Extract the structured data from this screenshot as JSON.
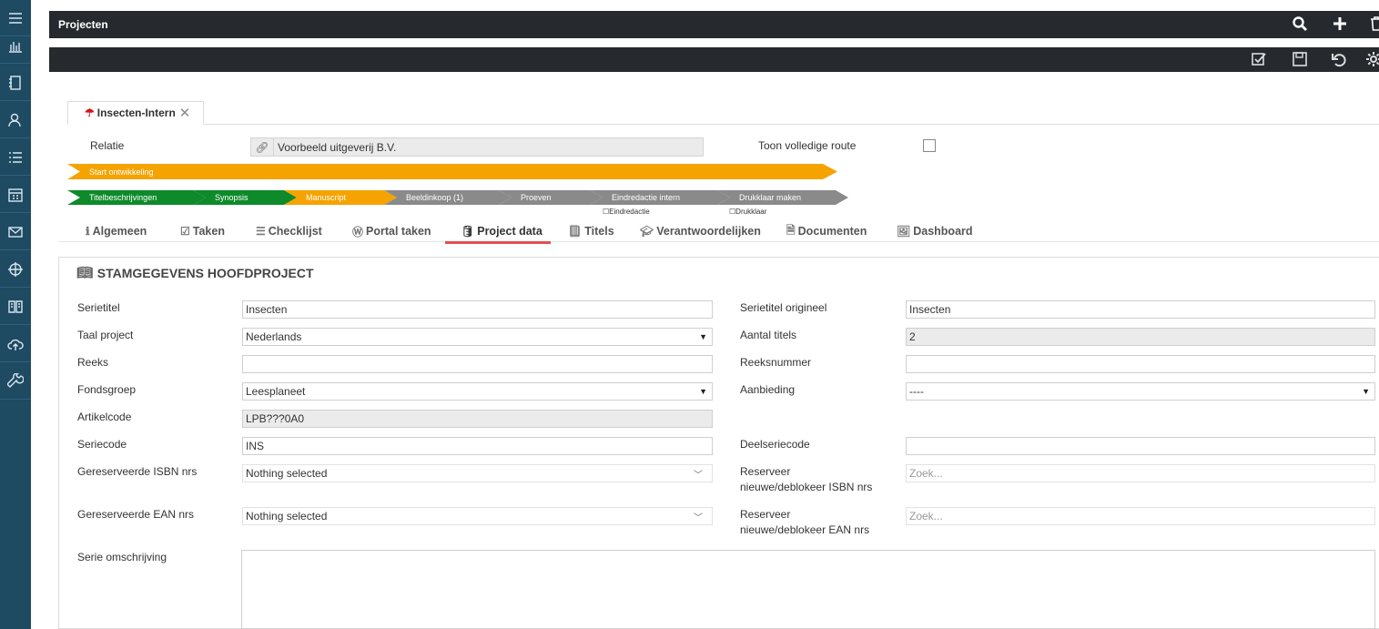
{
  "app": {
    "title": "Projecten"
  },
  "sidebar": {
    "items": [
      {
        "icon": "menu-icon"
      },
      {
        "icon": "bar-chart-icon"
      },
      {
        "icon": "notebook-icon"
      },
      {
        "icon": "users-icon"
      },
      {
        "icon": "list-icon"
      },
      {
        "icon": "calendar-icon"
      },
      {
        "icon": "mail-icon"
      },
      {
        "icon": "crosshair-icon"
      },
      {
        "icon": "book-icon"
      },
      {
        "icon": "cloud-upload-icon"
      },
      {
        "icon": "wrench-icon"
      }
    ]
  },
  "toolbar": {
    "top_icons": [
      "search-icon",
      "plus-icon",
      "trash-icon"
    ],
    "second_icons": [
      "checklist-icon",
      "save-icon",
      "undo-icon",
      "gear-icon"
    ]
  },
  "doc_tab": {
    "label": "Insecten-Intern"
  },
  "relatie": {
    "label": "Relatie",
    "value": "Voorbeeld uitgeverij B.V.",
    "route_label": "Toon volledige route"
  },
  "workflow": {
    "phase": "Start ontwikkeling",
    "stages": [
      {
        "label": "Titelbeschrijvingen",
        "status": "done"
      },
      {
        "label": "Synopsis",
        "status": "done"
      },
      {
        "label": "Manuscript",
        "status": "active"
      },
      {
        "label": "Beeldinkoop (1)",
        "status": "todo"
      },
      {
        "label": "Proeven",
        "status": "todo"
      },
      {
        "label": "Eindredactie intern",
        "status": "todo"
      },
      {
        "label": "Drukklaar maken",
        "status": "todo"
      }
    ],
    "subnotes": [
      "Eindredactie",
      "Drukklaar"
    ]
  },
  "tabs": [
    {
      "label": "Algemeen",
      "icon": "info-icon"
    },
    {
      "label": "Taken",
      "icon": "checkbox-icon"
    },
    {
      "label": "Checklijst",
      "icon": "list-icon"
    },
    {
      "label": "Portal taken",
      "icon": "wordpress-icon"
    },
    {
      "label": "Project data",
      "icon": "database-icon",
      "active": true
    },
    {
      "label": "Titels",
      "icon": "book-icon"
    },
    {
      "label": "Verantwoordelijken",
      "icon": "graduation-cap-icon"
    },
    {
      "label": "Documenten",
      "icon": "document-icon"
    },
    {
      "label": "Dashboard",
      "icon": "image-icon"
    }
  ],
  "panel": {
    "title": "STAMGEGEVENS HOOFDPROJECT",
    "left": {
      "serietitel": {
        "label": "Serietitel",
        "value": "Insecten"
      },
      "taal": {
        "label": "Taal project",
        "value": "Nederlands"
      },
      "reeks": {
        "label": "Reeks",
        "value": ""
      },
      "fondsgroep": {
        "label": "Fondsgroep",
        "value": "Leesplaneet"
      },
      "artikelcode": {
        "label": "Artikelcode",
        "value": "LPB???0A0"
      },
      "seriecode": {
        "label": "Seriecode",
        "value": "INS"
      },
      "isbn": {
        "label": "Gereserveerde ISBN nrs",
        "value": "Nothing selected"
      },
      "ean": {
        "label": "Gereserveerde EAN nrs",
        "value": "Nothing selected"
      },
      "omschrijving": {
        "label": "Serie omschrijving",
        "value": ""
      }
    },
    "right": {
      "serietitel_orig": {
        "label": "Serietitel origineel",
        "value": "Insecten"
      },
      "aantal_titels": {
        "label": "Aantal titels",
        "value": "2"
      },
      "reeksnummer": {
        "label": "Reeksnummer",
        "value": ""
      },
      "aanbieding": {
        "label": "Aanbieding",
        "value": "----"
      },
      "deelseriecode": {
        "label": "Deelseriecode",
        "value": ""
      },
      "reserveer_isbn": {
        "label_line1": "Reserveer",
        "label_line2": "nieuwe/deblokeer ISBN nrs",
        "placeholder": "Zoek..."
      },
      "reserveer_ean": {
        "label_line1": "Reserveer",
        "label_line2": "nieuwe/deblokeer EAN nrs",
        "placeholder": "Zoek..."
      }
    }
  },
  "colors": {
    "sidebar": "#1e4a62",
    "topbar": "#262a2e",
    "stage_done": "#0e8a2a",
    "stage_active": "#f5a300",
    "stage_todo": "#8a8a8a",
    "active_tab_underline": "#e05050"
  }
}
